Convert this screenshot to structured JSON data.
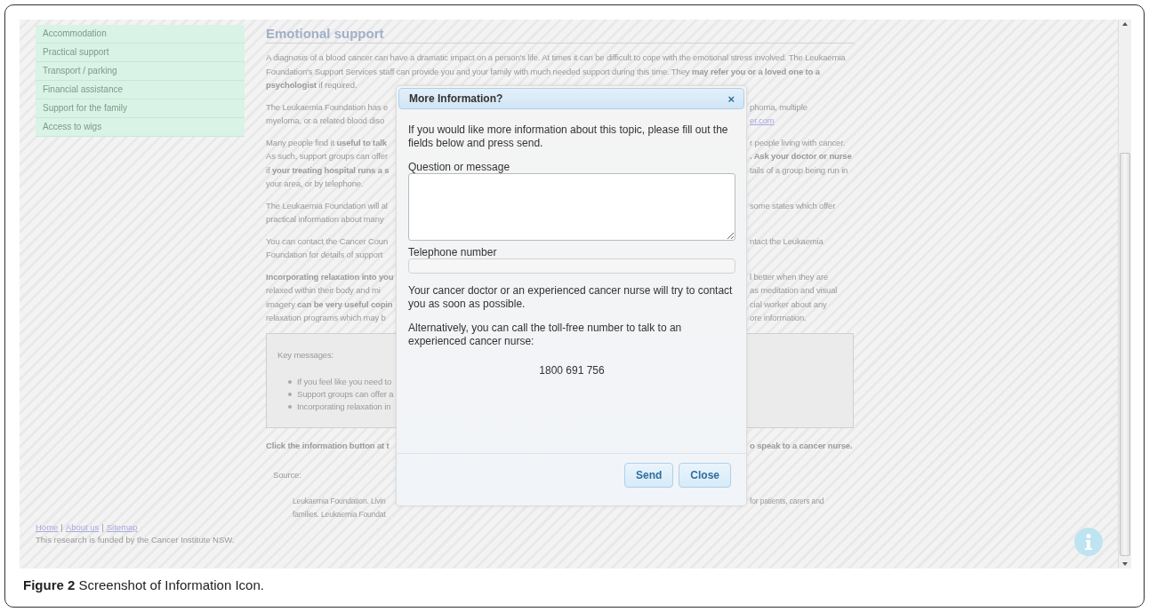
{
  "sidebar": {
    "items": [
      {
        "label": "Accommodation"
      },
      {
        "label": "Practical support"
      },
      {
        "label": "Transport / parking"
      },
      {
        "label": "Financial assistance"
      },
      {
        "label": "Support for the family"
      },
      {
        "label": "Access to wigs"
      }
    ]
  },
  "article": {
    "heading": "Emotional support",
    "intro": "A diagnosis of a blood cancer can have a dramatic impact on a person's life. At times it can be difficult to cope with the emotional stress involved. The Leukaemia Foundation's Support Services staff can provide you and your family with much needed support during this time. They **may refer you or a loved one to a psychologist** if required.",
    "paragraphs": [
      {
        "lines": [
          {
            "left": {
              "text": "The Leukaemia Foundation has e",
              "kind": "plain"
            },
            "right": {
              "text": "phoma, multiple",
              "kind": "plain"
            }
          },
          {
            "left": {
              "text": "myeloma, or a related blood diso",
              "kind": "plain"
            },
            "right": {
              "text": "er.com",
              "kind": "link"
            }
          }
        ]
      },
      {
        "lines": [
          {
            "left": {
              "text": "Many people find it **useful to talk**",
              "kind": "plain"
            },
            "right": {
              "text": "r people living with cancer.",
              "kind": "plain"
            }
          },
          {
            "left": {
              "text": "As such, support groups can offer",
              "kind": "plain"
            },
            "right": {
              "text": ". Ask your doctor or nurse",
              "kind": "bold"
            }
          },
          {
            "left": {
              "text": "if **your treating hospital runs a s**",
              "kind": "plain"
            },
            "right": {
              "text": "tails of a group being run in",
              "kind": "plain"
            }
          },
          {
            "left": {
              "text": "your area, or by telephone.",
              "kind": "plain"
            }
          }
        ]
      },
      {
        "lines": [
          {
            "left": {
              "text": "The Leukaemia Foundation will al",
              "kind": "plain"
            },
            "right": {
              "text": "some states which offer",
              "kind": "plain"
            }
          },
          {
            "left": {
              "text": "practical information about many",
              "kind": "plain"
            }
          }
        ]
      },
      {
        "lines": [
          {
            "left": {
              "text": "You can contact the Cancer Coun",
              "kind": "plain"
            },
            "right": {
              "text": "ntact the Leukaemia",
              "kind": "plain"
            }
          },
          {
            "left": {
              "text": "Foundation for details of support",
              "kind": "plain"
            }
          }
        ]
      },
      {
        "lines": [
          {
            "left": {
              "text": "Incorporating relaxation into you",
              "kind": "bold"
            },
            "right": {
              "text": "l better when they are",
              "kind": "plain"
            }
          },
          {
            "left": {
              "text": "relaxed within their body and mi",
              "kind": "plain"
            },
            "right": {
              "text": "as meditation and visual",
              "kind": "plain"
            }
          },
          {
            "left": {
              "text": "imagery **can be very useful copin**",
              "kind": "plain"
            },
            "right": {
              "text": "cial worker about any",
              "kind": "plain"
            }
          },
          {
            "left": {
              "text": "relaxation programs which may b",
              "kind": "plain"
            },
            "right": {
              "text": "ore information.",
              "kind": "plain"
            }
          }
        ]
      }
    ],
    "key_messages": {
      "title": "Key messages:",
      "bullets": [
        {
          "text": "If you feel like you need to"
        },
        {
          "text": "Support groups can offer a"
        },
        {
          "text": "Incorporating relaxation in"
        }
      ]
    },
    "call_to_action": {
      "left": {
        "text": "Click the information button at t",
        "kind": "bold"
      },
      "right": {
        "text": "o speak to a cancer nurse.",
        "kind": "bold"
      }
    },
    "source": {
      "label": "Source:",
      "lines": [
        {
          "left": {
            "text": "Leukaemia Foundation. Livin",
            "kind": "plain"
          },
          "right": {
            "text": "for patients, carers and",
            "kind": "plain"
          }
        },
        {
          "left": {
            "text": "families. Leukaemia Foundat",
            "kind": "plain"
          }
        }
      ]
    }
  },
  "footer": {
    "links": [
      "Home",
      "About us",
      "Sitemap"
    ],
    "separator": "|",
    "note": "This research is funded by the Cancer Institute NSW."
  },
  "modal": {
    "title": "More Information?",
    "close": "×",
    "intro": "If you would like more information about this topic, please fill out the fields below and press send.",
    "fields": [
      {
        "kind": "textarea",
        "label": "Question or message"
      },
      {
        "kind": "input",
        "label": "Telephone number"
      }
    ],
    "notes": [
      "Your cancer doctor or an experienced cancer nurse will try to contact you as soon as possible.",
      "Alternatively, you can call the toll-free number to talk to an experienced cancer nurse:"
    ],
    "phone": "1800 691 756",
    "buttons": [
      "Send",
      "Close"
    ]
  },
  "caption": "**Figure 2** Screenshot of Information Icon."
}
